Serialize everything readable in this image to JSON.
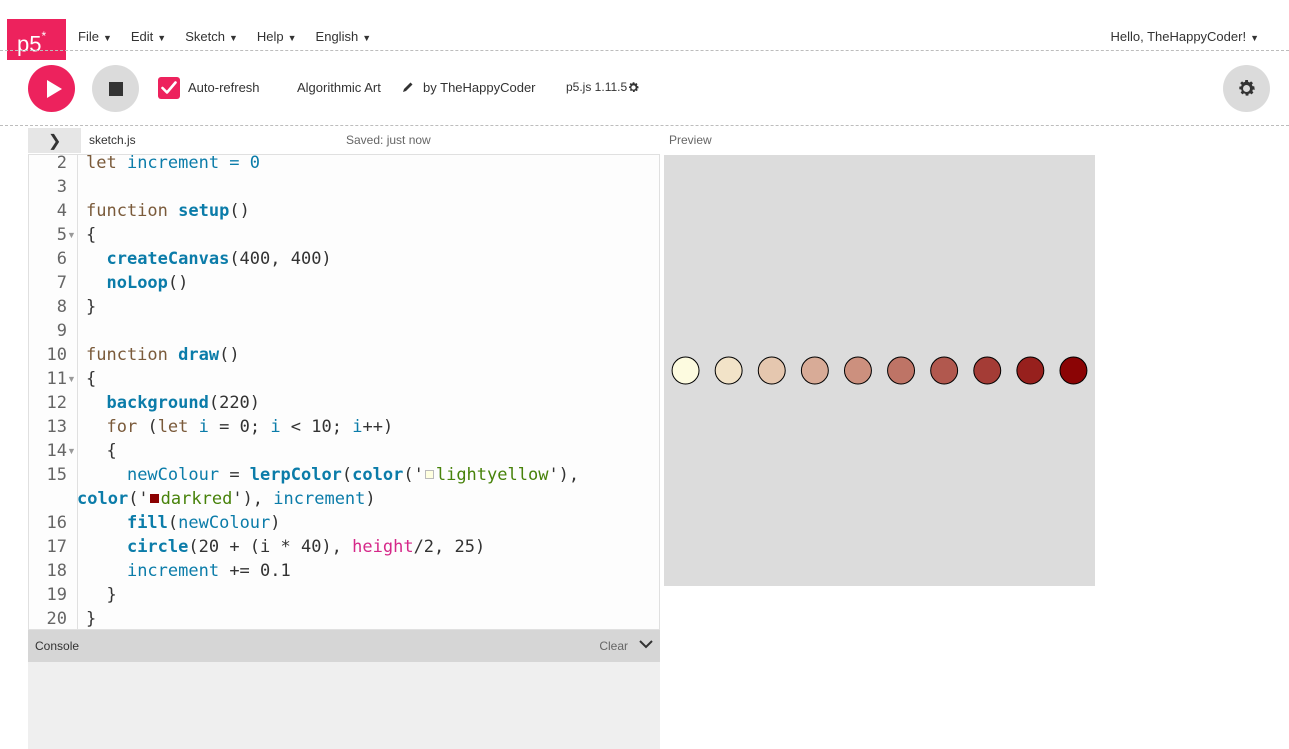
{
  "nav": {
    "logo": "p5",
    "logo_sup": "*",
    "menu": [
      "File",
      "Edit",
      "Sketch",
      "Help",
      "English"
    ],
    "user": "Hello, TheHappyCoder!"
  },
  "toolbar": {
    "play_icon": "play-icon",
    "stop_icon": "stop-icon",
    "auto_refresh_label": "Auto-refresh",
    "auto_refresh_checked": true,
    "project_name": "Algorithmic Art",
    "by": "by",
    "owner": "TheHappyCoder",
    "p5_version": "p5.js 1.11.5",
    "accent_color": "#ed225d"
  },
  "editor": {
    "file_name": "sketch.js",
    "saved_status": "Saved: just now",
    "gutter": [
      {
        "n": "2"
      },
      {
        "n": "3"
      },
      {
        "n": "4"
      },
      {
        "n": "5",
        "fold": true
      },
      {
        "n": "6"
      },
      {
        "n": "7"
      },
      {
        "n": "8"
      },
      {
        "n": "9"
      },
      {
        "n": "10"
      },
      {
        "n": "11",
        "fold": true
      },
      {
        "n": "12"
      },
      {
        "n": "13"
      },
      {
        "n": "14",
        "fold": true
      },
      {
        "n": "15"
      },
      {
        "n": ""
      },
      {
        "n": "16"
      },
      {
        "n": "17"
      },
      {
        "n": "18"
      },
      {
        "n": "19"
      },
      {
        "n": "20"
      }
    ],
    "code": {
      "l2": {
        "kw": "let",
        "rest": " increment = 0"
      },
      "l4": {
        "kw": "function",
        "name": "setup",
        "rest": "()"
      },
      "l5": "{",
      "l6": {
        "fn": "createCanvas",
        "rest": "(400, 400)"
      },
      "l7": {
        "fn": "noLoop",
        "rest": "()"
      },
      "l8": "}",
      "l10": {
        "kw": "function",
        "name": "draw",
        "rest": "()"
      },
      "l11": "{",
      "l12": {
        "fn": "background",
        "rest": "(220)"
      },
      "l13": {
        "kw1": "for",
        "p1": " (",
        "kw2": "let",
        "var1": " i",
        "p2": " = 0; ",
        "var2": "i",
        "p3": " < 10; ",
        "var3": "i",
        "p4": "++)"
      },
      "l14": "{",
      "l15": {
        "var": "newColour",
        "eq": " = ",
        "fn1": "lerpColor",
        "p1": "(",
        "fn2": "color",
        "p2": "('",
        "str": "lightyellow",
        "p3": "'),"
      },
      "l15b": {
        "fn": "color",
        "p1": "('",
        "str": "darkred",
        "p2": "'), ",
        "var": "increment",
        "p3": ")"
      },
      "l16": {
        "fn": "fill",
        "p1": "(",
        "var": "newColour",
        "p2": ")"
      },
      "l17": {
        "fn": "circle",
        "p1": "(20 + (i * 40), ",
        "h": "height",
        "p2": "/2, 25)"
      },
      "l18": {
        "var": "increment",
        "rest": " += 0.1"
      },
      "l19": "}",
      "l20": "}",
      "swatch_lightyellow": "#ffffe0",
      "swatch_darkred": "#8b0000"
    }
  },
  "console": {
    "label": "Console",
    "clear": "Clear"
  },
  "preview": {
    "label": "Preview",
    "background": "#dcdcdc",
    "circles": [
      "#fdfbe0",
      "#f2e3c8",
      "#e5c7af",
      "#d8ab97",
      "#cc907e",
      "#be7466",
      "#b1584e",
      "#a43c36",
      "#97201d",
      "#8b0405"
    ]
  }
}
